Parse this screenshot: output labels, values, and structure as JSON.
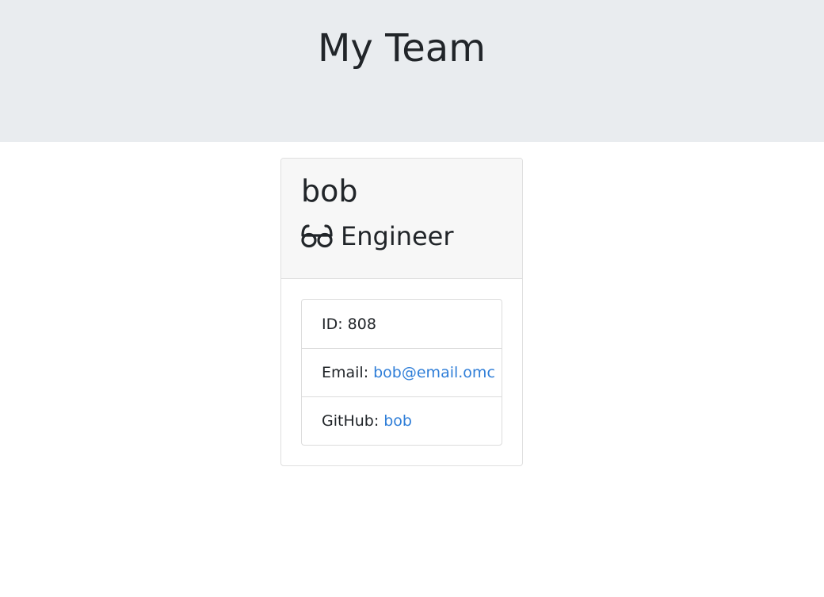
{
  "header": {
    "title": "My Team"
  },
  "card": {
    "name": "bob",
    "role": "Engineer",
    "role_icon": "glasses-icon",
    "details": {
      "id_label": "ID:",
      "id_value": "808",
      "email_label": "Email:",
      "email_value": "bob@email.omc",
      "github_label": "GitHub:",
      "github_value": "bob"
    }
  },
  "colors": {
    "header_bg": "#e9ecef",
    "link": "#2f7ed8",
    "card_header_bg": "#f7f7f7"
  }
}
